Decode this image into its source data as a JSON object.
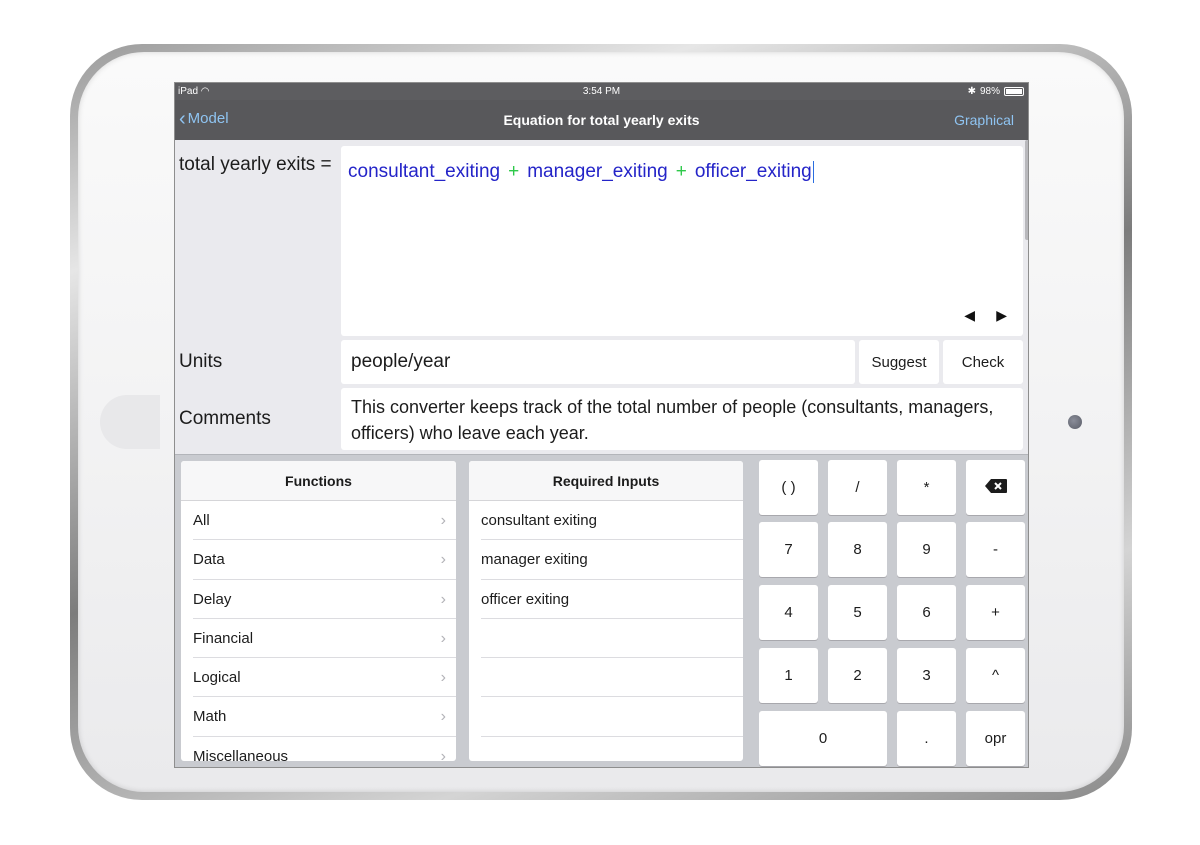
{
  "status_bar": {
    "device": "iPad",
    "time": "3:54 PM",
    "battery": "98%",
    "battery_level": 0.98
  },
  "nav": {
    "back_label": "Model",
    "title": "Equation for total yearly exits",
    "right_label": "Graphical"
  },
  "equation": {
    "label": "total yearly exits =",
    "terms": [
      "consultant_exiting",
      "manager_exiting",
      "officer_exiting"
    ],
    "operators": [
      "+",
      "+"
    ]
  },
  "units": {
    "label": "Units",
    "value": "people/year",
    "suggest_label": "Suggest",
    "check_label": "Check"
  },
  "comments": {
    "label": "Comments",
    "text": "This converter keeps track of the total number of people (consultants, managers, officers) who leave each year."
  },
  "functions": {
    "header": "Functions",
    "items": [
      "All",
      "Data",
      "Delay",
      "Financial",
      "Logical",
      "Math",
      "Miscellaneous"
    ]
  },
  "required_inputs": {
    "header": "Required Inputs",
    "items": [
      "consultant exiting",
      "manager exiting",
      "officer exiting"
    ]
  },
  "keypad": {
    "row1": [
      "( )",
      "/",
      "*"
    ],
    "row2": [
      "7",
      "8",
      "9",
      "-"
    ],
    "row3": [
      "4",
      "5",
      "6",
      "+"
    ],
    "row4": [
      "1",
      "2",
      "3",
      "^"
    ],
    "row5": [
      "0",
      ".",
      "opr"
    ]
  },
  "colors": {
    "nav_bg": "#58585b",
    "link": "#8fc4f2",
    "variable": "#2424c8",
    "operator": "#2ec94a"
  }
}
